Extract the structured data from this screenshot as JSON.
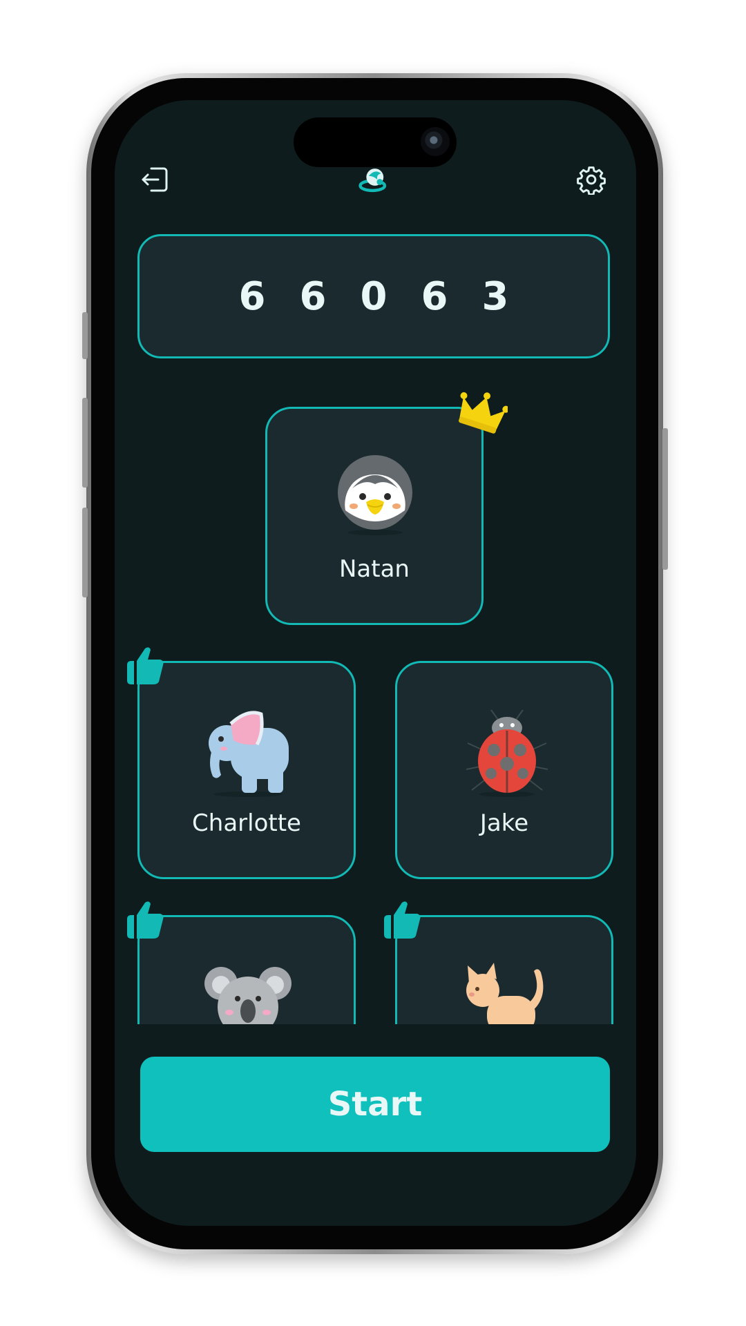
{
  "room_code": {
    "digits": [
      "6",
      "6",
      "0",
      "6",
      "3"
    ]
  },
  "host": {
    "name": "Natan",
    "avatar": "penguin-avatar",
    "badge": "crown-icon"
  },
  "players": [
    {
      "name": "Charlotte",
      "avatar": "elephant-avatar",
      "badge": "thumbs-up-icon"
    },
    {
      "name": "Jake",
      "avatar": "ladybug-avatar",
      "badge": null
    },
    {
      "name": "",
      "avatar": "koala-avatar",
      "badge": "thumbs-up-icon"
    },
    {
      "name": "",
      "avatar": "cat-avatar",
      "badge": "thumbs-up-icon"
    }
  ],
  "header": {
    "left_icon": "exit-icon",
    "center_icon": "app-logo-icon",
    "right_icon": "gear-icon"
  },
  "start_button": {
    "label": "Start"
  },
  "colors": {
    "background": "#0f1c1d",
    "card": "#1a2a2e",
    "accent": "#12b9b5",
    "button": "#10c0bd",
    "text": "#e9f7f6",
    "crown": "#f5d40f"
  }
}
